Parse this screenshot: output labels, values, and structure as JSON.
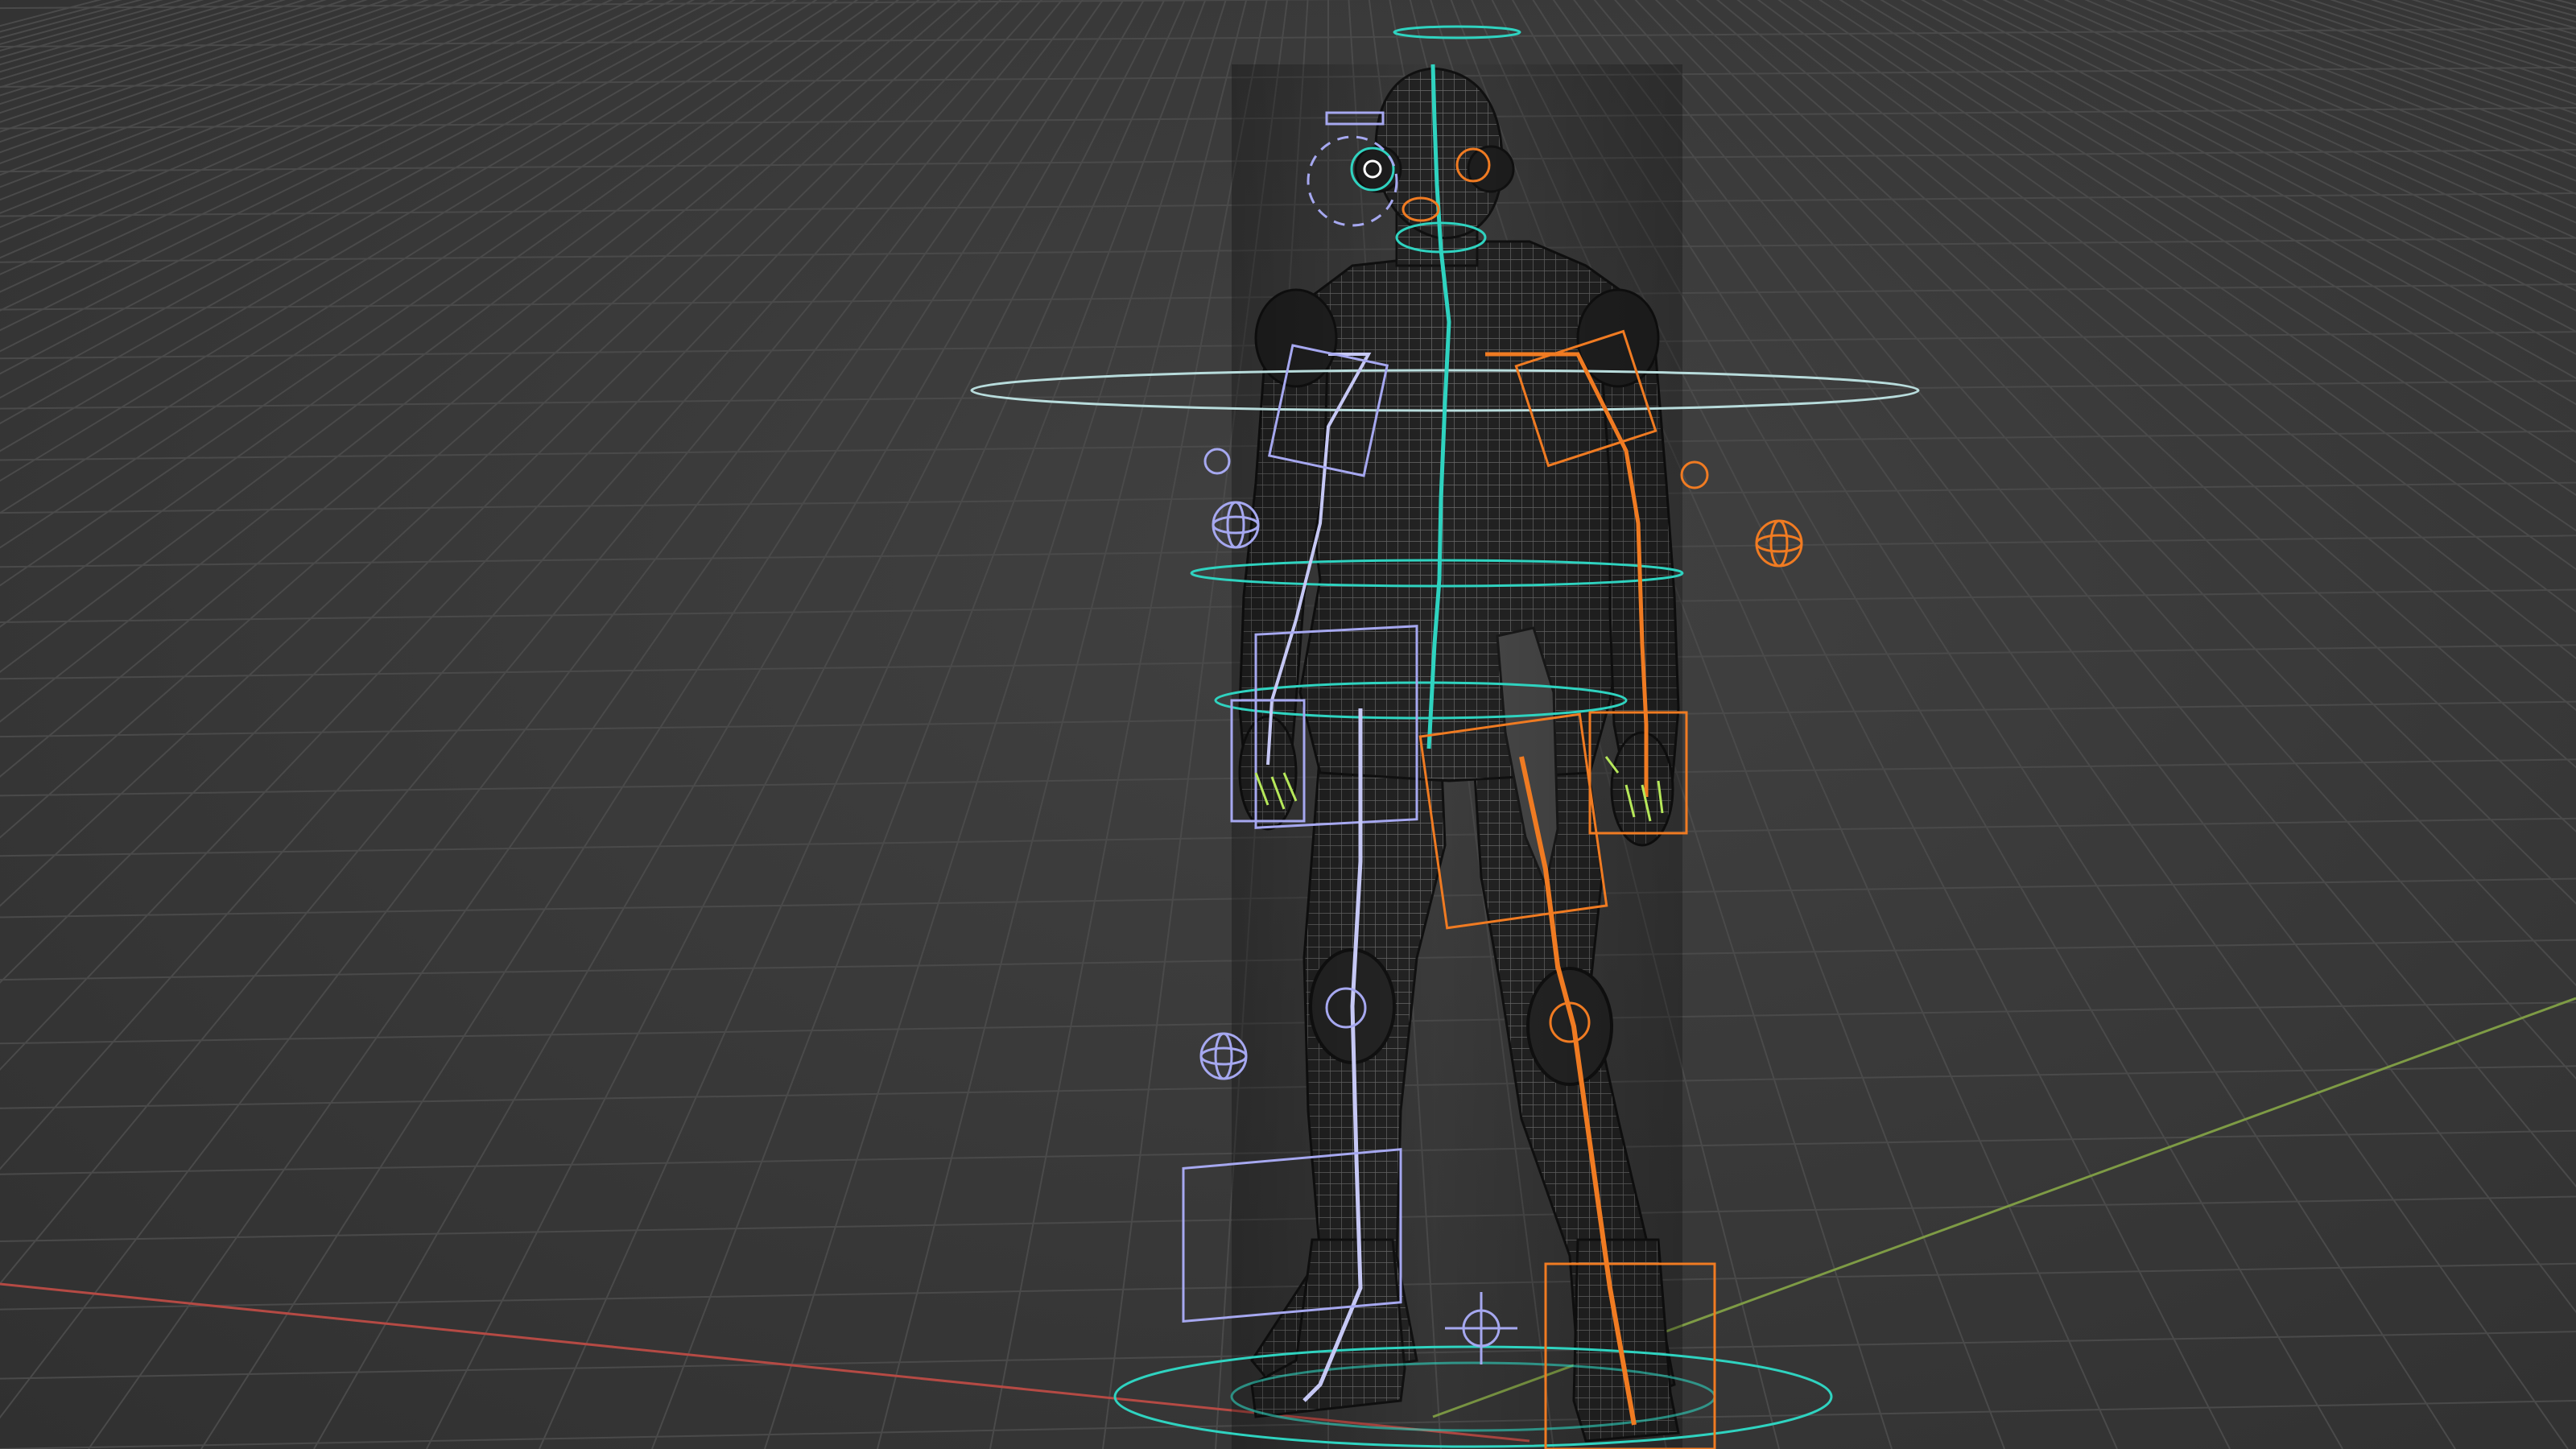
{
  "viewport": {
    "background_color": "#3a3a3a",
    "grid_color": "#4a4a4a",
    "x_axis_color": "#c0504a",
    "y_axis_color": "#8aa84a"
  },
  "rig": {
    "center_color": "#2fd3c0",
    "left_side_color": "#a6a8f0",
    "right_side_color": "#f07b22",
    "mesh_color": "#1c1c1c",
    "wire_color": "#7a7a7a"
  },
  "icons": {
    "eye_icon": "eye-control-icon",
    "gimbal_icon": "gimbal-control-icon",
    "cross_icon": "move-control-icon"
  }
}
